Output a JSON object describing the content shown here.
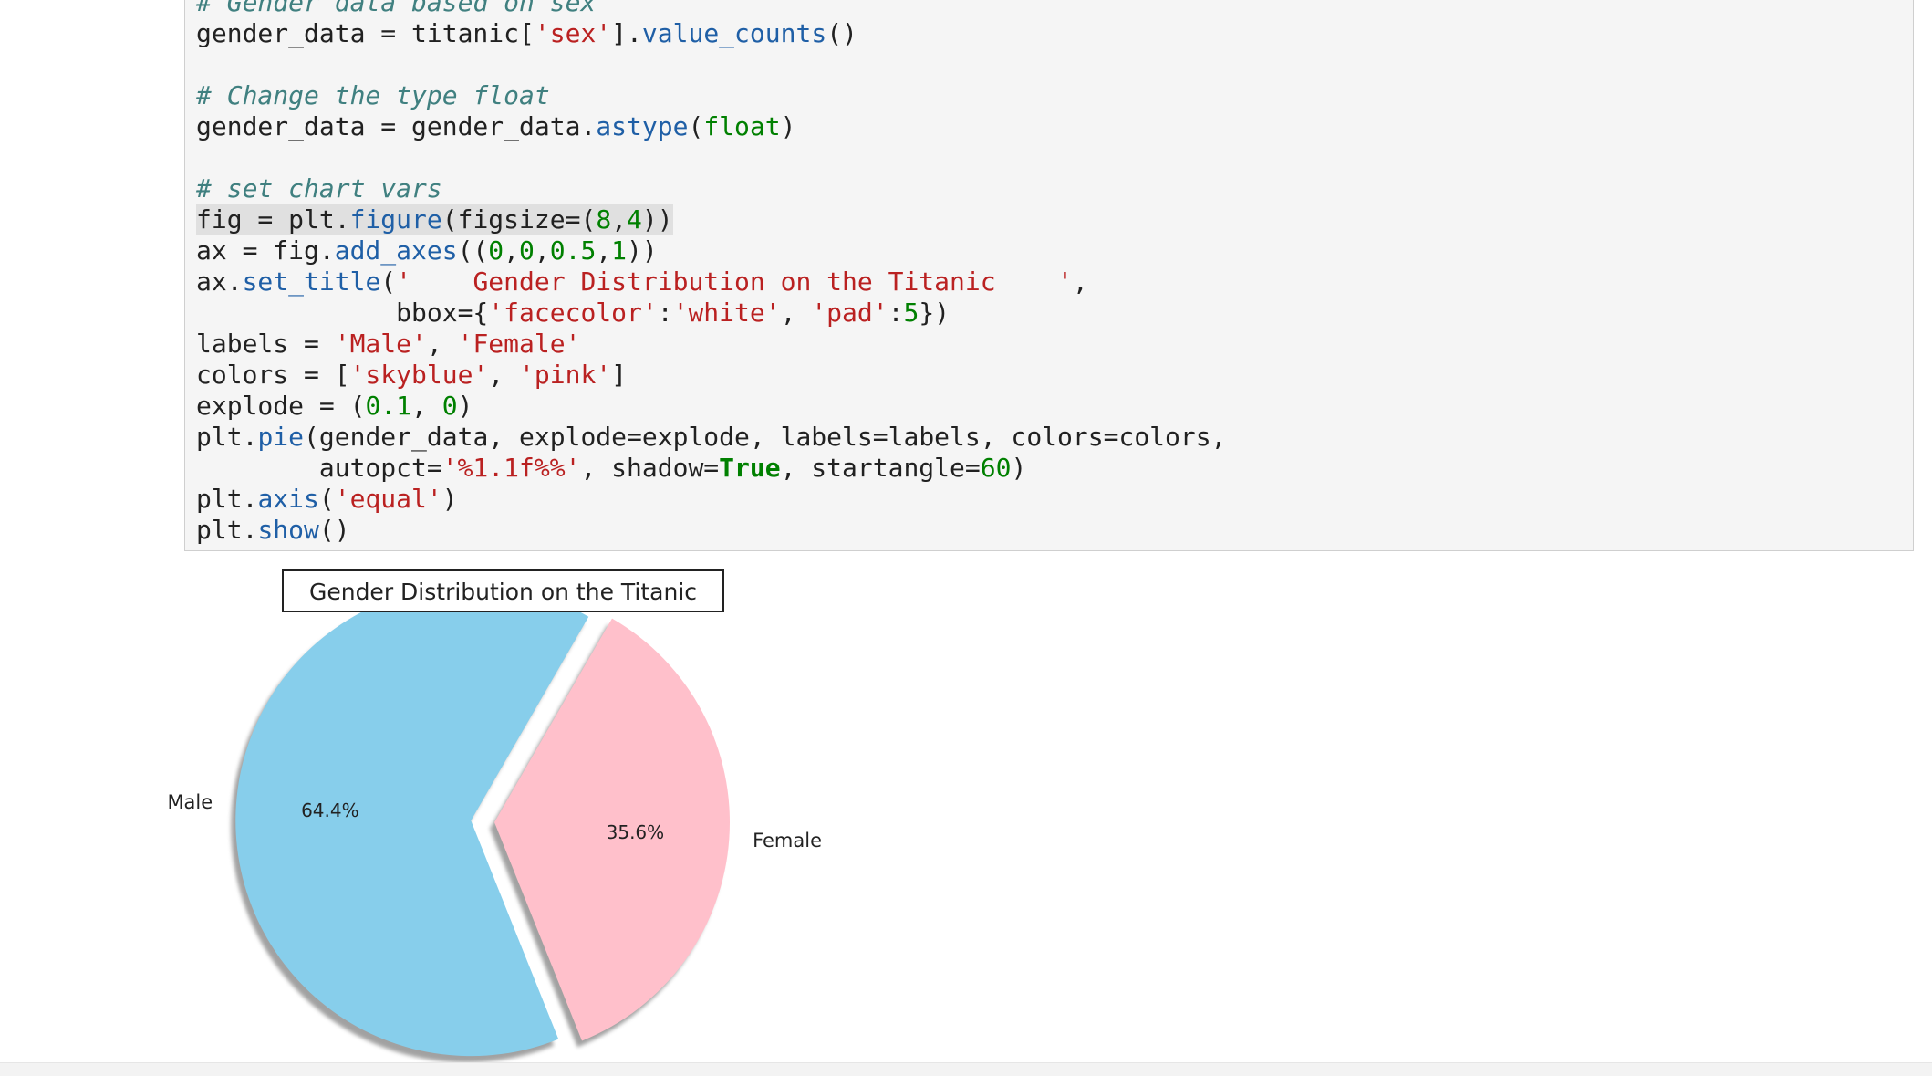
{
  "code_cell": {
    "lines": [
      [
        [
          "t-comment",
          "# Gender data based on sex"
        ]
      ],
      [
        [
          "t-plain",
          "gender_data = titanic["
        ],
        [
          "t-string",
          "'sex'"
        ],
        [
          "t-plain",
          "]."
        ],
        [
          "t-func",
          "value_counts"
        ],
        [
          "t-plain",
          "()"
        ]
      ],
      [],
      [
        [
          "t-comment",
          "# Change the type float"
        ]
      ],
      [
        [
          "t-plain",
          "gender_data = gender_data."
        ],
        [
          "t-func",
          "astype"
        ],
        [
          "t-plain",
          "("
        ],
        [
          "t-builtin",
          "float"
        ],
        [
          "t-plain",
          ")"
        ]
      ],
      [],
      [
        [
          "t-comment",
          "# set chart vars"
        ]
      ],
      [
        [
          "t-plain",
          "fig = plt."
        ],
        [
          "t-func",
          "figure"
        ],
        [
          "t-plain",
          "(figsize=("
        ],
        [
          "t-number",
          "8"
        ],
        [
          "t-plain",
          ","
        ],
        [
          "t-number",
          "4"
        ],
        [
          "t-plain",
          "))"
        ]
      ],
      [
        [
          "t-plain",
          "ax = fig."
        ],
        [
          "t-func",
          "add_axes"
        ],
        [
          "t-plain",
          "(("
        ],
        [
          "t-number",
          "0"
        ],
        [
          "t-plain",
          ","
        ],
        [
          "t-number",
          "0"
        ],
        [
          "t-plain",
          ","
        ],
        [
          "t-number",
          "0.5"
        ],
        [
          "t-plain",
          ","
        ],
        [
          "t-number",
          "1"
        ],
        [
          "t-plain",
          "))"
        ]
      ],
      [
        [
          "t-plain",
          "ax."
        ],
        [
          "t-func",
          "set_title"
        ],
        [
          "t-plain",
          "("
        ],
        [
          "t-string",
          "'    Gender Distribution on the Titanic    '"
        ],
        [
          "t-plain",
          ","
        ]
      ],
      [
        [
          "t-plain",
          "             bbox={"
        ],
        [
          "t-string",
          "'facecolor'"
        ],
        [
          "t-plain",
          ":"
        ],
        [
          "t-string",
          "'white'"
        ],
        [
          "t-plain",
          ", "
        ],
        [
          "t-string",
          "'pad'"
        ],
        [
          "t-plain",
          ":"
        ],
        [
          "t-number",
          "5"
        ],
        [
          "t-plain",
          "})"
        ]
      ],
      [
        [
          "t-plain",
          "labels = "
        ],
        [
          "t-string",
          "'Male'"
        ],
        [
          "t-plain",
          ", "
        ],
        [
          "t-string",
          "'Female'"
        ]
      ],
      [
        [
          "t-plain",
          "colors = ["
        ],
        [
          "t-string",
          "'skyblue'"
        ],
        [
          "t-plain",
          ", "
        ],
        [
          "t-string",
          "'pink'"
        ],
        [
          "t-plain",
          "]"
        ]
      ],
      [
        [
          "t-plain",
          "explode = ("
        ],
        [
          "t-number",
          "0.1"
        ],
        [
          "t-plain",
          ", "
        ],
        [
          "t-number",
          "0"
        ],
        [
          "t-plain",
          ")"
        ]
      ],
      [
        [
          "t-plain",
          "plt."
        ],
        [
          "t-func",
          "pie"
        ],
        [
          "t-plain",
          "(gender_data, explode=explode, labels=labels, colors=colors,"
        ]
      ],
      [
        [
          "t-plain",
          "        autopct="
        ],
        [
          "t-string",
          "'%1.1f%%'"
        ],
        [
          "t-plain",
          ", shadow="
        ],
        [
          "t-keyword",
          "True"
        ],
        [
          "t-plain",
          ", startangle="
        ],
        [
          "t-number",
          "60"
        ],
        [
          "t-plain",
          ")"
        ]
      ],
      [
        [
          "t-plain",
          "plt."
        ],
        [
          "t-func",
          "axis"
        ],
        [
          "t-plain",
          "("
        ],
        [
          "t-string",
          "'equal'"
        ],
        [
          "t-plain",
          ")"
        ]
      ],
      [
        [
          "t-plain",
          "plt."
        ],
        [
          "t-func",
          "show"
        ],
        [
          "t-plain",
          "()"
        ]
      ]
    ],
    "highlighted_line": 7
  },
  "chart_data": {
    "type": "pie",
    "title": "Gender Distribution on the Titanic",
    "categories": [
      "Male",
      "Female"
    ],
    "values": [
      64.4,
      35.6
    ],
    "value_labels": [
      "64.4%",
      "35.6%"
    ],
    "colors": [
      "#87ceeb",
      "#ffc0cb"
    ],
    "explode": [
      0.1,
      0
    ],
    "start_angle": 60,
    "shadow": true
  }
}
